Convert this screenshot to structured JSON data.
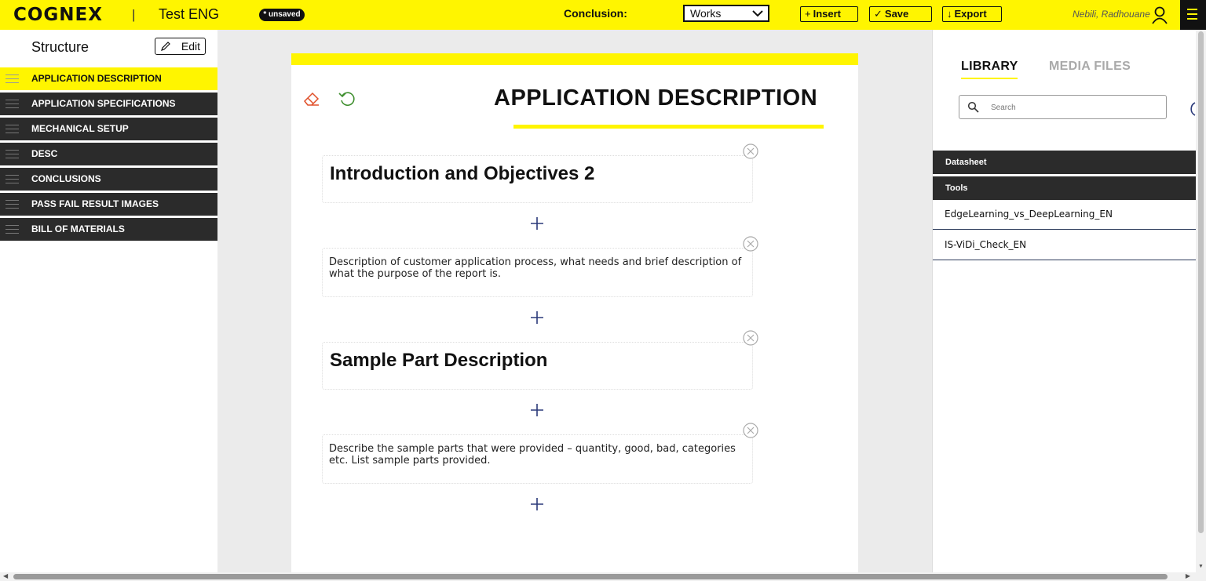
{
  "header": {
    "logo": "COGNEX",
    "separator": "|",
    "project_title": "Test ENG",
    "unsaved_badge": "* unsaved",
    "conclusion_label": "Conclusion:",
    "conclusion_value": "Works",
    "insert_label": "Insert",
    "save_label": "Save",
    "export_label": "Export",
    "user_name": "Nebili, Radhouane"
  },
  "sidebar": {
    "title": "Structure",
    "edit_label": "Edit",
    "items": [
      {
        "label": "APPLICATION DESCRIPTION",
        "active": true
      },
      {
        "label": "APPLICATION SPECIFICATIONS",
        "active": false
      },
      {
        "label": "MECHANICAL SETUP",
        "active": false
      },
      {
        "label": "DESC",
        "active": false
      },
      {
        "label": "CONCLUSIONS",
        "active": false
      },
      {
        "label": "PASS FAIL RESULT IMAGES",
        "active": false
      },
      {
        "label": "BILL OF MATERIALS",
        "active": false
      }
    ]
  },
  "document": {
    "title": "APPLICATION DESCRIPTION",
    "blocks": [
      {
        "type": "heading",
        "text": "Introduction and Objectives 2"
      },
      {
        "type": "paragraph",
        "text": "Description of customer application process, what needs and brief description of what the purpose of the report is."
      },
      {
        "type": "heading",
        "text": "Sample Part Description"
      },
      {
        "type": "paragraph",
        "text": "Describe the sample parts that were provided – quantity, good, bad, categories etc. List sample parts provided."
      }
    ]
  },
  "library": {
    "tab_library": "LIBRARY",
    "tab_media": "MEDIA FILES",
    "search_placeholder": "Search",
    "categories": [
      "Datasheet",
      "Tools"
    ],
    "items": [
      "EdgeLearning_vs_DeepLearning_EN",
      "IS-ViDi_Check_EN"
    ]
  },
  "colors": {
    "brand_yellow": "#fff500",
    "dark": "#2b2b2b",
    "eraser": "#e0502a",
    "undo": "#3f8f2f",
    "plus": "#2b3a7a"
  }
}
